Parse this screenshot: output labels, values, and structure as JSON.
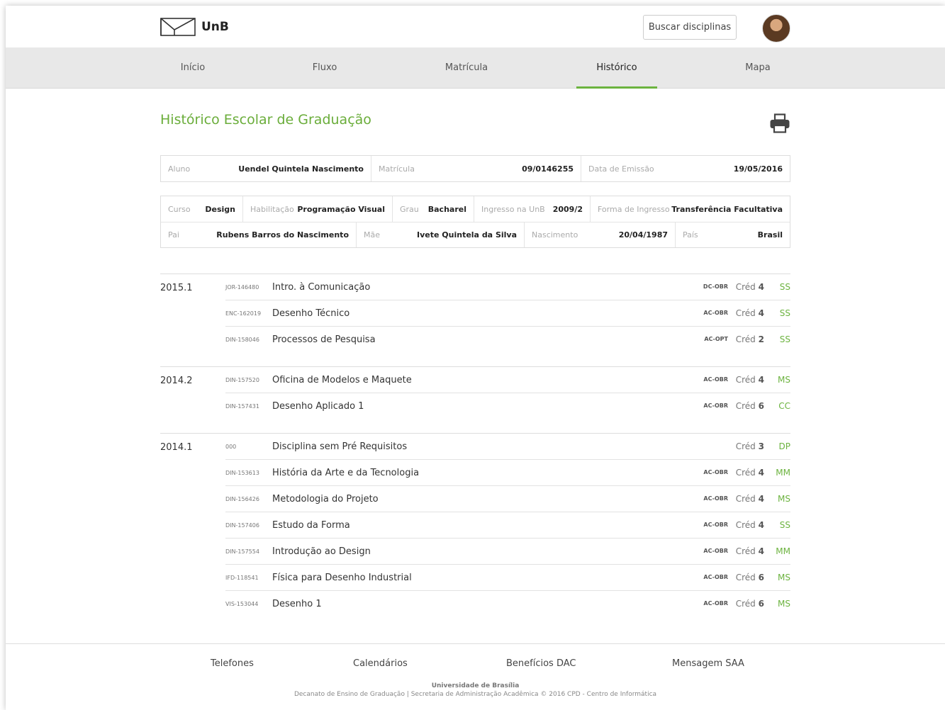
{
  "header": {
    "logo_text": "UnB",
    "search_button": "Buscar disciplinas"
  },
  "nav": {
    "items": [
      "Início",
      "Fluxo",
      "Matrícula",
      "Histórico",
      "Mapa"
    ],
    "active": "Histórico"
  },
  "page": {
    "title": "Histórico Escolar de Graduação"
  },
  "student": {
    "aluno_label": "Aluno",
    "aluno": "Uendel Quintela Nascimento",
    "matricula_label": "Matrícula",
    "matricula": "09/0146255",
    "emissao_label": "Data de Emissão",
    "emissao": "19/05/2016"
  },
  "details": {
    "curso_label": "Curso",
    "curso": "Design",
    "habilitacao_label": "Habilitação",
    "habilitacao": "Programação Visual",
    "grau_label": "Grau",
    "grau": "Bacharel",
    "ingresso_label": "Ingresso na UnB",
    "ingresso": "2009/2",
    "forma_label": "Forma de Ingresso",
    "forma": "Transferência Facultativa",
    "pai_label": "Pai",
    "pai": "Rubens Barros do Nascimento",
    "mae_label": "Mãe",
    "mae": "Ivete Quintela da Silva",
    "nasc_label": "Nascimento",
    "nascimento": "20/04/1987",
    "pais_label": "País",
    "pais": "Brasil"
  },
  "cred_label": "Créd",
  "semesters": [
    {
      "label": "2015.1",
      "courses": [
        {
          "code": "JOR-146480",
          "name": "Intro. à Comunicação",
          "type": "DC-OBR",
          "credits": "4",
          "grade": "SS"
        },
        {
          "code": "ENC-162019",
          "name": "Desenho Técnico",
          "type": "AC-OBR",
          "credits": "4",
          "grade": "SS"
        },
        {
          "code": "DIN-158046",
          "name": "Processos de Pesquisa",
          "type": "AC-OPT",
          "credits": "2",
          "grade": "SS"
        }
      ]
    },
    {
      "label": "2014.2",
      "courses": [
        {
          "code": "DIN-157520",
          "name": "Oficina de Modelos e Maquete",
          "type": "AC-OBR",
          "credits": "4",
          "grade": "MS"
        },
        {
          "code": "DIN-157431",
          "name": "Desenho Aplicado 1",
          "type": "AC-OBR",
          "credits": "6",
          "grade": "CC"
        }
      ]
    },
    {
      "label": "2014.1",
      "courses": [
        {
          "code": "000",
          "name": "Disciplina sem Pré Requisitos",
          "type": "",
          "credits": "3",
          "grade": "DP"
        },
        {
          "code": "DIN-153613",
          "name": "História da Arte e da Tecnologia",
          "type": "AC-OBR",
          "credits": "4",
          "grade": "MM"
        },
        {
          "code": "DIN-156426",
          "name": "Metodologia do Projeto",
          "type": "AC-OBR",
          "credits": "4",
          "grade": "MS"
        },
        {
          "code": "DIN-157406",
          "name": "Estudo da Forma",
          "type": "AC-OBR",
          "credits": "4",
          "grade": "SS"
        },
        {
          "code": "DIN-157554",
          "name": "Introdução ao Design",
          "type": "AC-OBR",
          "credits": "4",
          "grade": "MM"
        },
        {
          "code": "IFD-118541",
          "name": "Física para Desenho Industrial",
          "type": "AC-OBR",
          "credits": "6",
          "grade": "MS"
        },
        {
          "code": "VIS-153044",
          "name": "Desenho 1",
          "type": "AC-OBR",
          "credits": "6",
          "grade": "MS"
        }
      ]
    }
  ],
  "footer": {
    "links": [
      "Telefones",
      "Calendários",
      "Benefícios DAC",
      "Mensagem SAA"
    ],
    "org": "Universidade de Brasília",
    "meta": "Decanato de Ensino de Graduação | Secretaria de Administração Acadêmica  © 2016 CPD - Centro de Informática"
  },
  "colors": {
    "accent": "#6cb33f",
    "nav_bg": "#e8e8e8"
  },
  "icons": {
    "logo": "unb-logo-icon",
    "print": "printer-icon",
    "avatar": "user-avatar"
  }
}
